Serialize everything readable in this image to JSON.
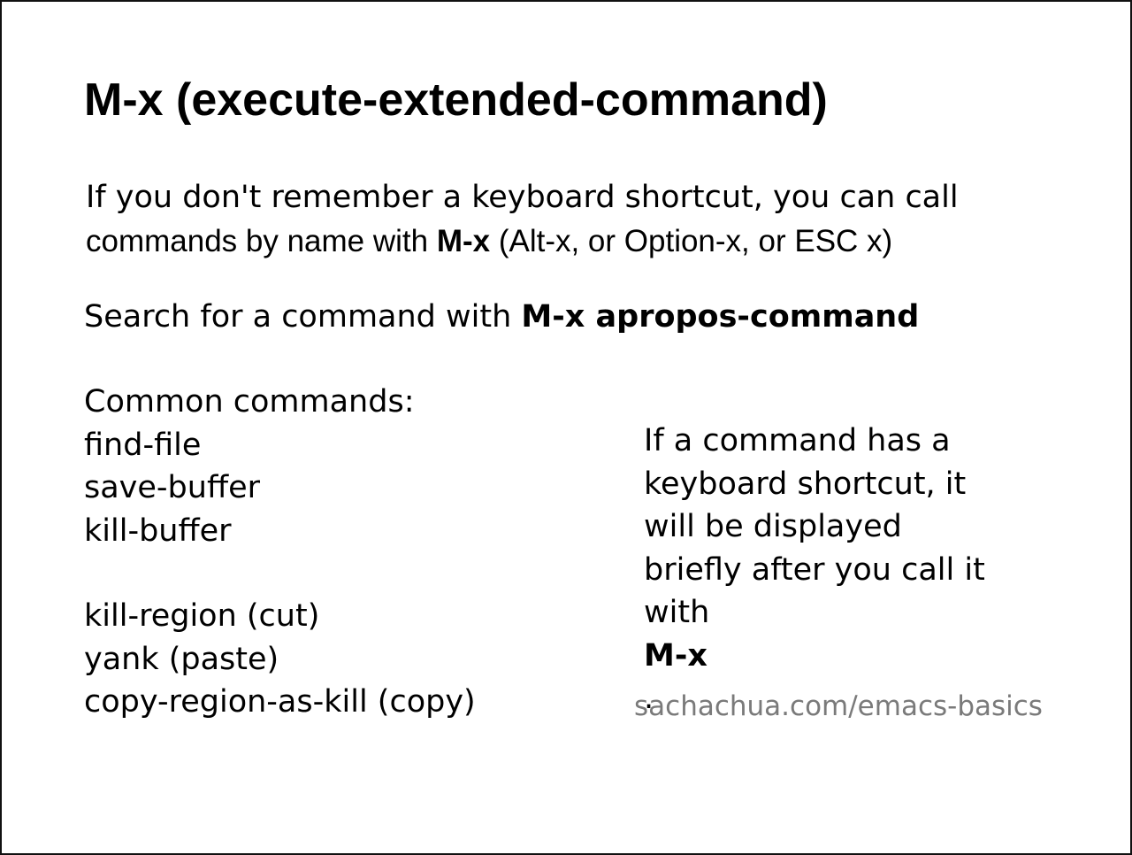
{
  "title": "M-x (execute-extended-command)",
  "intro": {
    "line1": "If you don't remember a keyboard shortcut, you can call",
    "line2_prefix": "commands by name with ",
    "line2_bold": "M-x",
    "line2_suffix": " (Alt-x, or Option-x, or ESC x)"
  },
  "search": {
    "prefix": "Search for a command with ",
    "bold": "M-x apropos-command"
  },
  "commands": {
    "heading": "Common commands:",
    "group1": [
      "find-file",
      "save-buffer",
      "kill-buffer"
    ],
    "group2": [
      "kill-region (cut)",
      "yank (paste)",
      "copy-region-as-kill (copy)"
    ]
  },
  "note": {
    "lines": [
      "If a command has a",
      "keyboard shortcut, it",
      "will be displayed",
      "briefly after you call it"
    ],
    "last_prefix": "with ",
    "last_bold": "M-x",
    "last_suffix": "."
  },
  "url": "sachachua.com/emacs-basics",
  "colors": {
    "text": "#000000",
    "url": "#7a7a7a",
    "border": "#111111",
    "background": "#ffffff"
  }
}
